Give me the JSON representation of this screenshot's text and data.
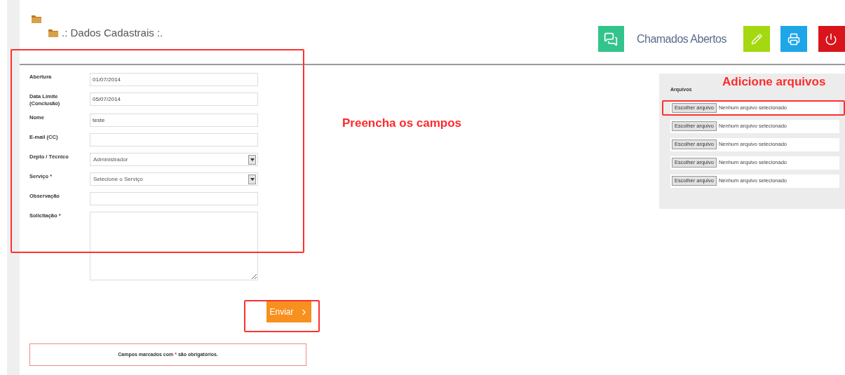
{
  "header": {
    "title": ".: Dados Cadastrais :.",
    "open_tickets": "Chamados Abertos"
  },
  "form": {
    "fields": [
      {
        "kind": "text",
        "label": "Abertura",
        "value": "01/07/2014"
      },
      {
        "kind": "text",
        "label": "Data Limite (Conclusão)",
        "value": "05/07/2014"
      },
      {
        "kind": "text",
        "label": "Nome",
        "value": "teste"
      },
      {
        "kind": "text",
        "label": "E-mail (CC)"
      },
      {
        "kind": "select",
        "label": "Depto / Técnico",
        "value": "Administrador"
      },
      {
        "kind": "select",
        "label": "Serviço *",
        "value": "Selecione o Serviço"
      },
      {
        "kind": "text",
        "label": "Observação"
      },
      {
        "kind": "textarea",
        "label": "Solicitação *"
      }
    ],
    "submit": "Enviar",
    "note": {
      "before": "Campos marcados com",
      "mark": "*",
      "after": "são obrigatórios."
    }
  },
  "files": {
    "title": "Arquivos",
    "rows": [
      {
        "button": "Escolher arquivo",
        "status": "Nenhum arquivo selecionado"
      },
      {
        "button": "Escolher arquivo",
        "status": "Nenhum arquivo selecionado"
      },
      {
        "button": "Escolher arquivo",
        "status": "Nenhum arquivo selecionado"
      },
      {
        "button": "Escolher arquivo",
        "status": "Nenhum arquivo selecionado"
      },
      {
        "button": "Escolher arquivo",
        "status": "Nenhum arquivo selecionado"
      }
    ]
  },
  "annotations": [
    {
      "text": "Preencha os campos"
    },
    {
      "text": "Adicione arquivos"
    }
  ]
}
